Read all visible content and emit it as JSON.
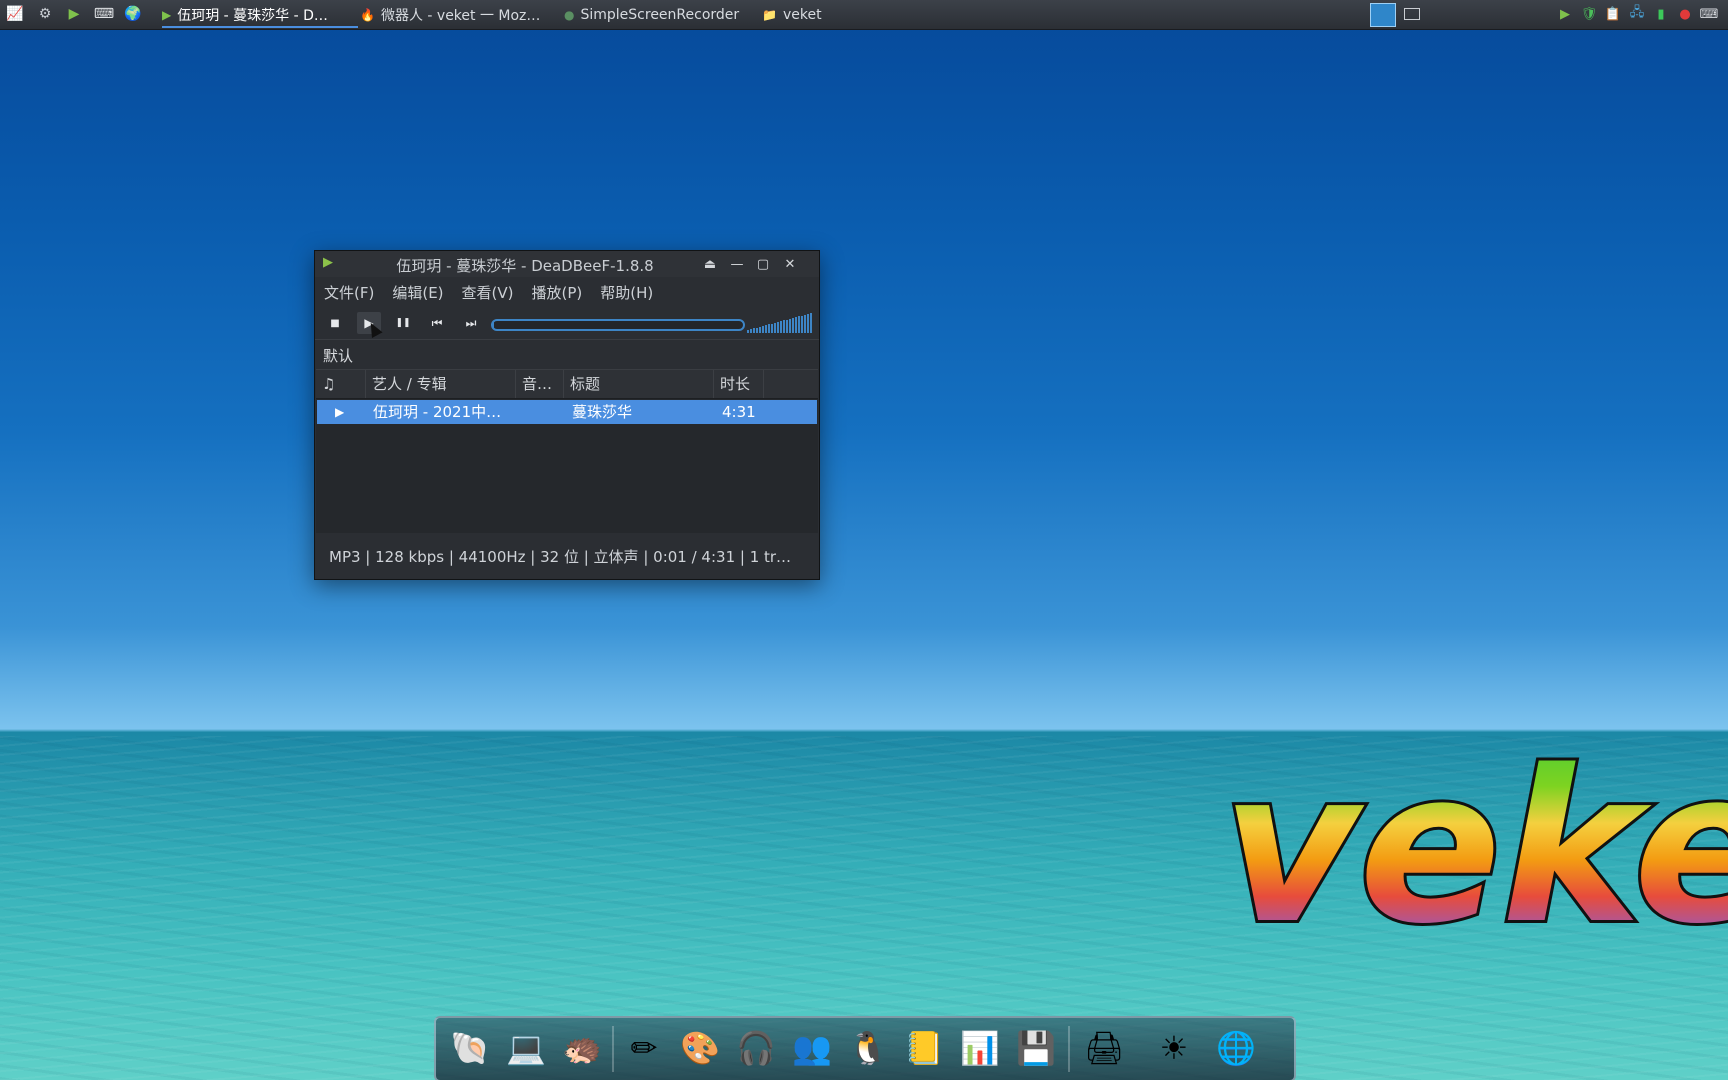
{
  "taskbar": {
    "launchers": [
      {
        "name": "system-monitor-icon",
        "glyph": "📈"
      },
      {
        "name": "settings-icon",
        "glyph": "⚙"
      },
      {
        "name": "media-player-icon",
        "glyph": "▶"
      },
      {
        "name": "terminal-icon",
        "glyph": "⌨"
      },
      {
        "name": "browser-icon",
        "glyph": "🌍"
      }
    ],
    "tasks": [
      {
        "label": "伍珂玥 - 蔓珠莎华 - D…",
        "glyph": "▶"
      },
      {
        "label": "微器人 - veket 一 Moz…",
        "glyph": "🔥"
      },
      {
        "label": "SimpleScreenRecorder",
        "glyph": "●"
      },
      {
        "label": "veket",
        "glyph": "📁"
      }
    ],
    "tray": [
      "▶",
      "🛡",
      "📋",
      "🖧",
      "▮",
      "●",
      "⌨"
    ]
  },
  "player": {
    "title": "伍珂玥 - 蔓珠莎华 - DeaDBeeF-1.8.8",
    "window_buttons": {
      "eject": "⏏",
      "minimize": "—",
      "maximize": "▢",
      "close": "✕"
    },
    "menu": [
      "文件(F)",
      "编辑(E)",
      "查看(V)",
      "播放(P)",
      "帮助(H)"
    ],
    "toolbar": {
      "stop": "■",
      "play": "▶",
      "pause": "❚❚",
      "prev": "⏮",
      "next": "⏭"
    },
    "seek_progress": 0.004,
    "volume_level": 1.0,
    "playlist_tab": "默认",
    "columns": {
      "icon": "♫",
      "artist_album": "艺人 / 专辑",
      "tracknum": "音…",
      "title": "标题",
      "duration": "时长"
    },
    "tracks": [
      {
        "state": "▶",
        "artist_album": "伍珂玥 - 2021中…",
        "title": "蔓珠莎华",
        "duration": "4:31"
      }
    ],
    "status": "MP3 | 128 kbps | 44100Hz | 32 位 | 立体声 | 0:01 / 4:31 | 1 tr…"
  },
  "desktop": {
    "logo_text": "veket"
  },
  "dock": {
    "items": [
      "🐚",
      "💻",
      "🦔",
      "✏",
      "🎨",
      "🎧",
      "👥",
      "🐧",
      "📒",
      "📊",
      "💾",
      "🖨",
      "☀",
      "🌐"
    ]
  }
}
